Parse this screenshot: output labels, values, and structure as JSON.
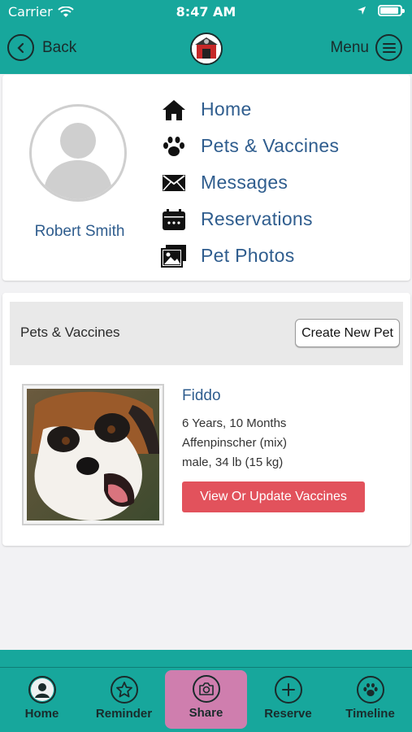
{
  "status_bar": {
    "carrier": "Carrier",
    "time": "8:47 AM"
  },
  "nav": {
    "back_label": "Back",
    "menu_label": "Menu"
  },
  "profile": {
    "name": "Robert Smith",
    "menu": [
      {
        "label": "Home",
        "icon": "home-icon"
      },
      {
        "label": "Pets & Vaccines",
        "icon": "paw-icon"
      },
      {
        "label": "Messages",
        "icon": "envelope-icon"
      },
      {
        "label": "Reservations",
        "icon": "calendar-icon"
      },
      {
        "label": "Pet Photos",
        "icon": "photos-icon"
      }
    ]
  },
  "pets": {
    "title": "Pets & Vaccines",
    "create_label": "Create New Pet",
    "pet": {
      "name": "Fiddo",
      "age": "6 Years, 10 Months",
      "breed": "Affenpinscher (mix)",
      "sex_weight": "male, 34 lb (15 kg)",
      "vaccine_button": "View Or Update Vaccines"
    }
  },
  "tabs": [
    {
      "label": "Home",
      "icon": "user-icon"
    },
    {
      "label": "Reminder",
      "icon": "star-icon"
    },
    {
      "label": "Share",
      "icon": "camera-icon",
      "active": true
    },
    {
      "label": "Reserve",
      "icon": "plus-icon"
    },
    {
      "label": "Timeline",
      "icon": "paw-icon"
    }
  ],
  "colors": {
    "teal": "#17a79c",
    "link_blue": "#2f5d8e",
    "red_button": "#e2525c",
    "active_tab": "#cf7eae"
  }
}
